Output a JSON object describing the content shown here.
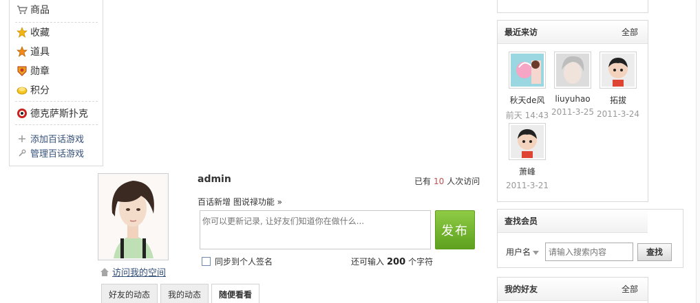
{
  "sidebar": {
    "items": [
      {
        "label": "商品",
        "icon": "cart-icon"
      },
      {
        "label": "收藏",
        "icon": "star-icon"
      },
      {
        "label": "道具",
        "icon": "tool-star-icon"
      },
      {
        "label": "勋章",
        "icon": "medal-icon"
      },
      {
        "label": "积分",
        "icon": "coins-icon"
      },
      {
        "label": "德克萨斯扑克",
        "icon": "poker-chip-icon"
      }
    ],
    "add_game": "添加百话游戏",
    "manage_game": "管理百话游戏"
  },
  "profile": {
    "username": "admin",
    "visit_prefix": "已有",
    "visit_count": "10",
    "visit_suffix": "人次访问",
    "visit_space": "访问我的空间"
  },
  "composer": {
    "news_prefix": "百话新增",
    "news_link": "图说禄功能 »",
    "placeholder": "你可以更新记录, 让好友们知道你在做什么...",
    "publish": "发布",
    "sync_label": "同步到个人签名",
    "remain_prefix": "还可输入",
    "remain_count": "200",
    "remain_suffix": "个字符"
  },
  "tabs": [
    {
      "label": "好友的动态",
      "active": false
    },
    {
      "label": "我的动态",
      "active": false
    },
    {
      "label": "随便看看",
      "active": true
    }
  ],
  "recent_visitors": {
    "title": "最近来访",
    "more": "全部",
    "visitors": [
      {
        "name": "秋天de风",
        "time": "前天 14:43"
      },
      {
        "name": "liuyuhao",
        "time": "2011-3-25"
      },
      {
        "name": "拓拔",
        "time": "2011-3-24"
      },
      {
        "name": "萧峰",
        "time": "2011-3-21"
      }
    ]
  },
  "find_member": {
    "title": "查找会员",
    "field_label": "用户名",
    "placeholder": "请输入搜索内容",
    "button": "查找"
  },
  "friends": {
    "title": "我的好友",
    "more": "全部"
  },
  "colors": {
    "accent_green": "#6fb52c",
    "link_blue": "#334f7a",
    "count_red": "#c0504d"
  }
}
